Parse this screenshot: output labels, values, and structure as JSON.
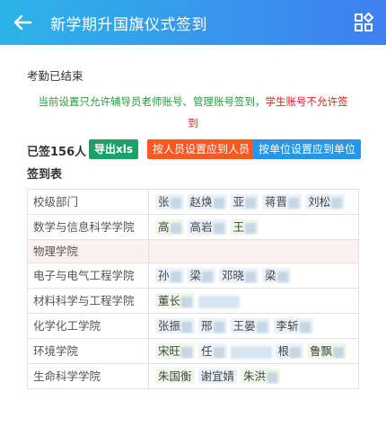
{
  "header": {
    "title": "新学期升国旗仪式签到",
    "back_icon": "arrow-left-icon",
    "menu_icon": "grid-menu-icon"
  },
  "status": {
    "text": "考勤已结束"
  },
  "notice": {
    "allowed": "当前设置只允许辅导员老师账号、管理账号签到，",
    "forbidden_line1": "学生账号不允许签",
    "forbidden_line2": "到"
  },
  "summary": {
    "signed": "已签156人",
    "export_label": "导出xls",
    "by_person_label": "按人员设置应到人员",
    "by_unit_label": "按单位设置应到单位"
  },
  "table": {
    "title": "签到表",
    "rows": [
      {
        "dept": "校级部门",
        "names": [
          "张",
          "赵焕",
          "亚",
          "蒋晋",
          "刘松"
        ]
      },
      {
        "dept": "数学与信息科学学院",
        "names": [
          "高",
          "高岩",
          "王"
        ]
      },
      {
        "dept": "物理学院",
        "names": []
      },
      {
        "dept": "电子与电气工程学院",
        "names": [
          "孙",
          "梁",
          "邓晓",
          "梁"
        ]
      },
      {
        "dept": "材料科学与工程学院",
        "names": [
          "董长",
          ""
        ]
      },
      {
        "dept": "化学化工学院",
        "names": [
          "张振",
          "邢",
          "王晏",
          "李斩"
        ]
      },
      {
        "dept": "环境学院",
        "names": [
          "宋旺",
          "任",
          "",
          "根",
          "鲁飘"
        ]
      },
      {
        "dept": "生命科学学院",
        "names": [
          "朱国衡",
          "谢宜婧",
          "朱洪"
        ]
      }
    ]
  },
  "colors": {
    "header_start": "#2cb4e8",
    "header_end": "#3f7ff0",
    "export_btn": "#1aa368",
    "person_btn": "#ff5722",
    "unit_btn": "#2196f3",
    "allowed_text": "#2a9a3c",
    "forbidden_text": "#e02020"
  }
}
